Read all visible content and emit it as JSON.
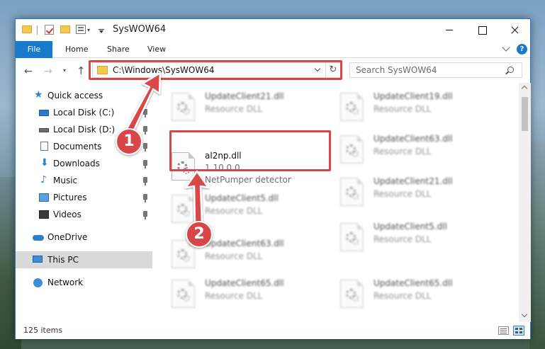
{
  "window": {
    "title": "SysWOW64"
  },
  "ribbon": {
    "tabs": [
      "File",
      "Home",
      "Share",
      "View"
    ],
    "help": "?"
  },
  "navigation": {
    "address": "C:\\Windows\\SysWOW64",
    "search_placeholder": "Search SysWOW64",
    "refresh_icon": "↻"
  },
  "sidebar": {
    "items": [
      {
        "label": "Quick access",
        "icon": "star-icon"
      },
      {
        "label": "Local Disk (C:)",
        "icon": "drive-icon",
        "pinned": true
      },
      {
        "label": "Local Disk (D:)",
        "icon": "drive-icon",
        "pinned": true
      },
      {
        "label": "Documents",
        "icon": "document-icon",
        "pinned": true
      },
      {
        "label": "Downloads",
        "icon": "download-icon",
        "pinned": true
      },
      {
        "label": "Music",
        "icon": "music-icon",
        "pinned": true
      },
      {
        "label": "Pictures",
        "icon": "picture-icon",
        "pinned": true
      },
      {
        "label": "Videos",
        "icon": "video-icon",
        "pinned": true
      },
      {
        "label": "OneDrive",
        "icon": "cloud-icon"
      },
      {
        "label": "This PC",
        "icon": "pc-icon",
        "selected": true
      },
      {
        "label": "Network",
        "icon": "network-icon"
      }
    ]
  },
  "files": {
    "highlighted": {
      "name": "al2np.dll",
      "version": "1.10.0.0",
      "description": "NetPumper detector"
    },
    "left_column": [
      {
        "name": "UpdateClient21.dll",
        "type": "Resource DLL"
      },
      {
        "name": "UpdateClient5.dll",
        "type": "Resource DLL"
      },
      {
        "name": "UpdateClient63.dll",
        "type": "Resource DLL"
      },
      {
        "name": "UpdateClient65.dll",
        "type": "Resource DLL"
      }
    ],
    "right_column": [
      {
        "name": "UpdateClient19.dll",
        "type": "Resource DLL"
      },
      {
        "name": "UpdateClient63.dll",
        "type": "Resource DLL"
      },
      {
        "name": "UpdateClient21.dll",
        "type": "Resource DLL"
      },
      {
        "name": "UpdateClient5.dll",
        "type": "Resource DLL"
      },
      {
        "name": "UpdateClient65.dll",
        "type": "Resource DLL"
      }
    ]
  },
  "status": {
    "item_count": "125 items"
  },
  "annotations": {
    "step1": "1",
    "step2": "2",
    "color": "#d9464a"
  }
}
